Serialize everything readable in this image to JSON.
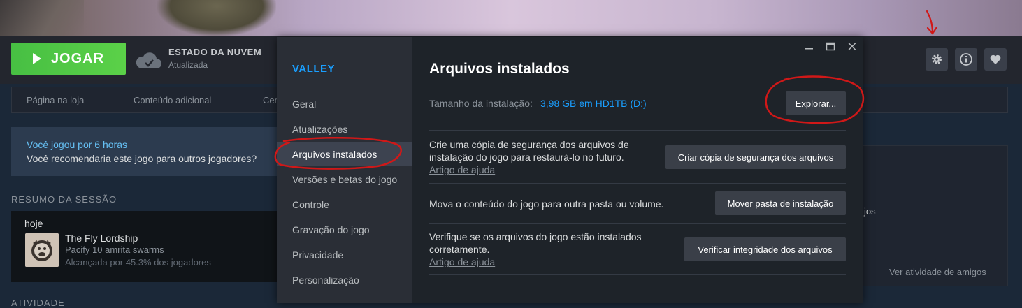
{
  "header": {
    "play_label": "JOGAR",
    "cloud_title": "ESTADO DA NUVEM",
    "cloud_status": "Atualizada"
  },
  "subnav": {
    "items": [
      "Página na loja",
      "Conteúdo adicional",
      "Cen"
    ]
  },
  "recommend": {
    "played": "Você jogou por 6 horas",
    "question": "Você recomendaria este jogo para outros jogadores?"
  },
  "session": {
    "title": "RESUMO DA SESSÃO",
    "day": "hoje",
    "achievement_title": "The Fly Lordship",
    "achievement_desc": "Pacify 10 amrita swarms",
    "achievement_pct": "Alcançada por 45.3% dos jogadores"
  },
  "activity": {
    "title": "ATIVIDADE"
  },
  "friends": {
    "fragment": "jos",
    "link": "Ver atividade de amigos"
  },
  "dialog": {
    "brand": "VALLEY",
    "nav": [
      "Geral",
      "Atualizações",
      "Arquivos instalados",
      "Versões e betas do jogo",
      "Controle",
      "Gravação do jogo",
      "Privacidade",
      "Personalização"
    ],
    "active_index": 2,
    "title": "Arquivos instalados",
    "size_label": "Tamanho da instalação:",
    "size_value": "3,98 GB em HD1TB (D:)",
    "explore_label": "Explorar...",
    "backup_text_1": "Crie uma cópia de segurança dos arquivos de",
    "backup_text_2": "instalação do jogo para restaurá-lo no futuro.",
    "help_label": "Artigo de ajuda",
    "backup_button": "Criar cópia de segurança dos arquivos",
    "move_text": "Mova o conteúdo do jogo para outra pasta ou volume.",
    "move_button": "Mover pasta de instalação",
    "verify_text_1": "Verifique se os arquivos do jogo estão instalados",
    "verify_text_2": "corretamente.",
    "verify_button": "Verificar integridade dos arquivos"
  },
  "colors": {
    "accent": "#1a9fff",
    "play": "#5bd148",
    "annotation": "#d01818"
  }
}
